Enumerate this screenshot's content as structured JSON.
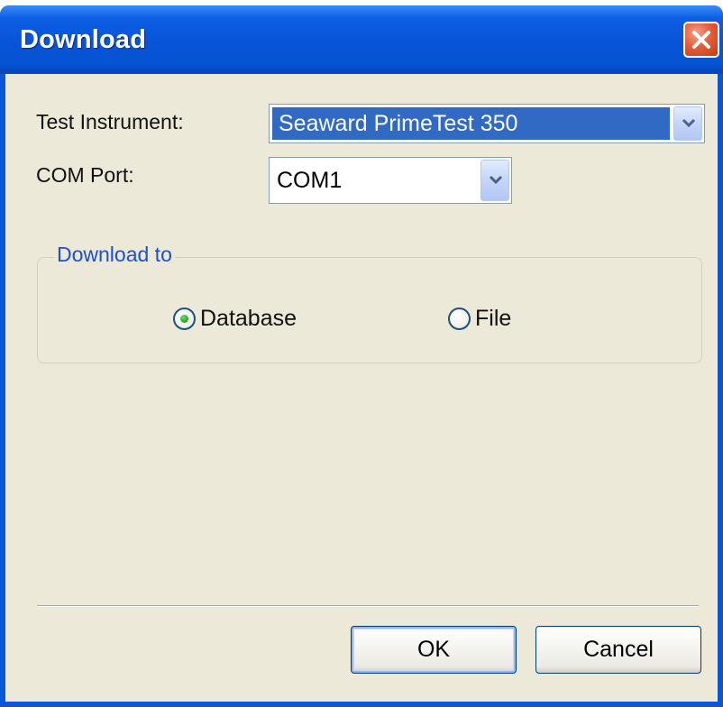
{
  "window": {
    "title": "Download"
  },
  "form": {
    "instrument_label": "Test Instrument:",
    "instrument_value": "Seaward PrimeTest 350",
    "com_port_label": "COM Port:",
    "com_port_value": "COM1"
  },
  "download_to": {
    "legend": "Download to",
    "options": [
      {
        "label": "Database",
        "selected": true
      },
      {
        "label": "File",
        "selected": false
      }
    ]
  },
  "buttons": {
    "ok_label": "OK",
    "cancel_label": "Cancel"
  },
  "colors": {
    "titlebar": "#0754d6",
    "dialog_bg": "#ece9d8",
    "selection": "#316ac5",
    "group_legend": "#1e4fd0",
    "close_button": "#e25f3c"
  },
  "icons": {
    "close": "close-icon",
    "dropdown": "chevron-down-icon",
    "radio_selected": "radio-selected-icon",
    "radio_unselected": "radio-unselected-icon"
  }
}
